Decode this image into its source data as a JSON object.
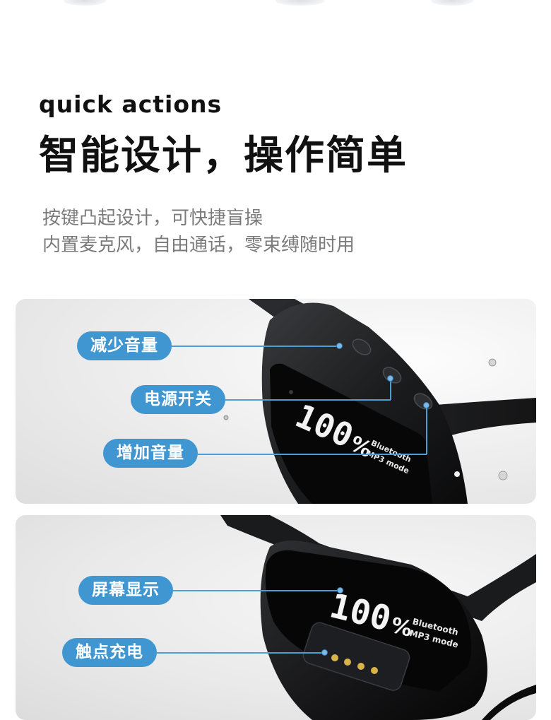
{
  "header": {
    "eyebrow": "quick actions",
    "headline": "智能设计，操作简单",
    "lines": [
      "按键凸起设计，可快捷盲操",
      "内置麦克风，自由通话，零束缚随时用"
    ]
  },
  "panel_one": {
    "labels": {
      "volume_down": "减少音量",
      "power": "电源开关",
      "volume_up": "增加音量"
    },
    "display": {
      "percent": "100",
      "percent_sign": "%",
      "line1": "Bluetooth",
      "line2": "MP3 mode"
    }
  },
  "panel_two": {
    "labels": {
      "screen": "屏幕显示",
      "contacts": "触点充电"
    },
    "display": {
      "percent": "100",
      "percent_sign": "%",
      "line1": "Bluetooth",
      "line2": "MP3 mode"
    }
  },
  "colors": {
    "accent": "#3f96d0",
    "headline": "#111111",
    "body_text": "#7b7b7b"
  }
}
